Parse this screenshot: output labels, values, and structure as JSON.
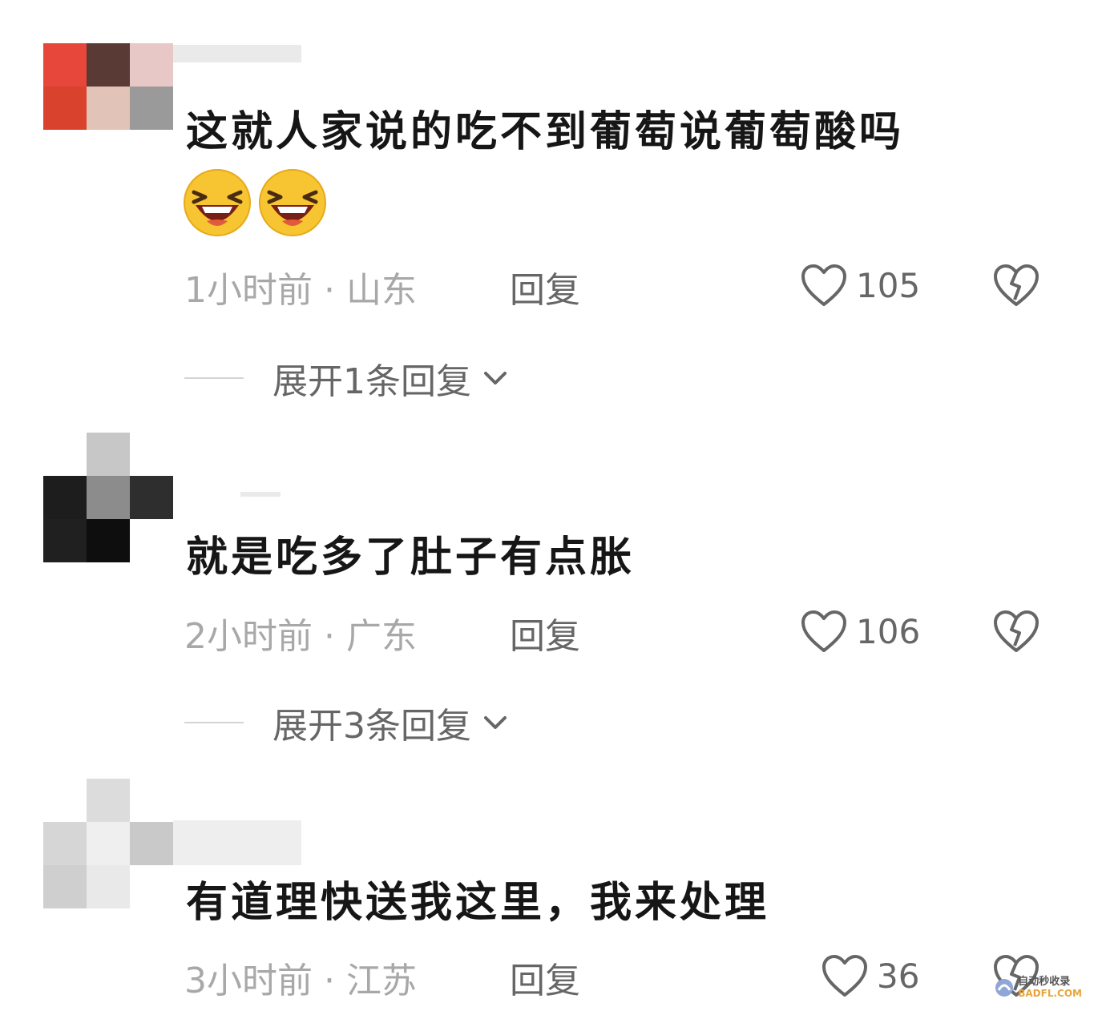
{
  "colors": {
    "meta": "#a8a8a8",
    "action": "#666666",
    "text": "#161616",
    "emoji_face": "#f7c531"
  },
  "comments": [
    {
      "text": "这就人家说的吃不到葡萄说葡萄酸吗",
      "emojis": [
        "laughing-emoji",
        "laughing-emoji"
      ],
      "time": "1小时前",
      "location": "山东",
      "reply_label": "回复",
      "likes": "105",
      "expand_label": "展开1条回复"
    },
    {
      "text": "就是吃多了肚子有点胀",
      "time": "2小时前",
      "location": "广东",
      "reply_label": "回复",
      "likes": "106",
      "expand_label": "展开3条回复"
    },
    {
      "text": "有道理快送我这里，我来处理",
      "time": "3小时前",
      "location": "江苏",
      "reply_label": "回复",
      "likes": "36"
    }
  ],
  "watermark": {
    "line1": "自动秒收录",
    "line2": "BADFL.COM"
  }
}
